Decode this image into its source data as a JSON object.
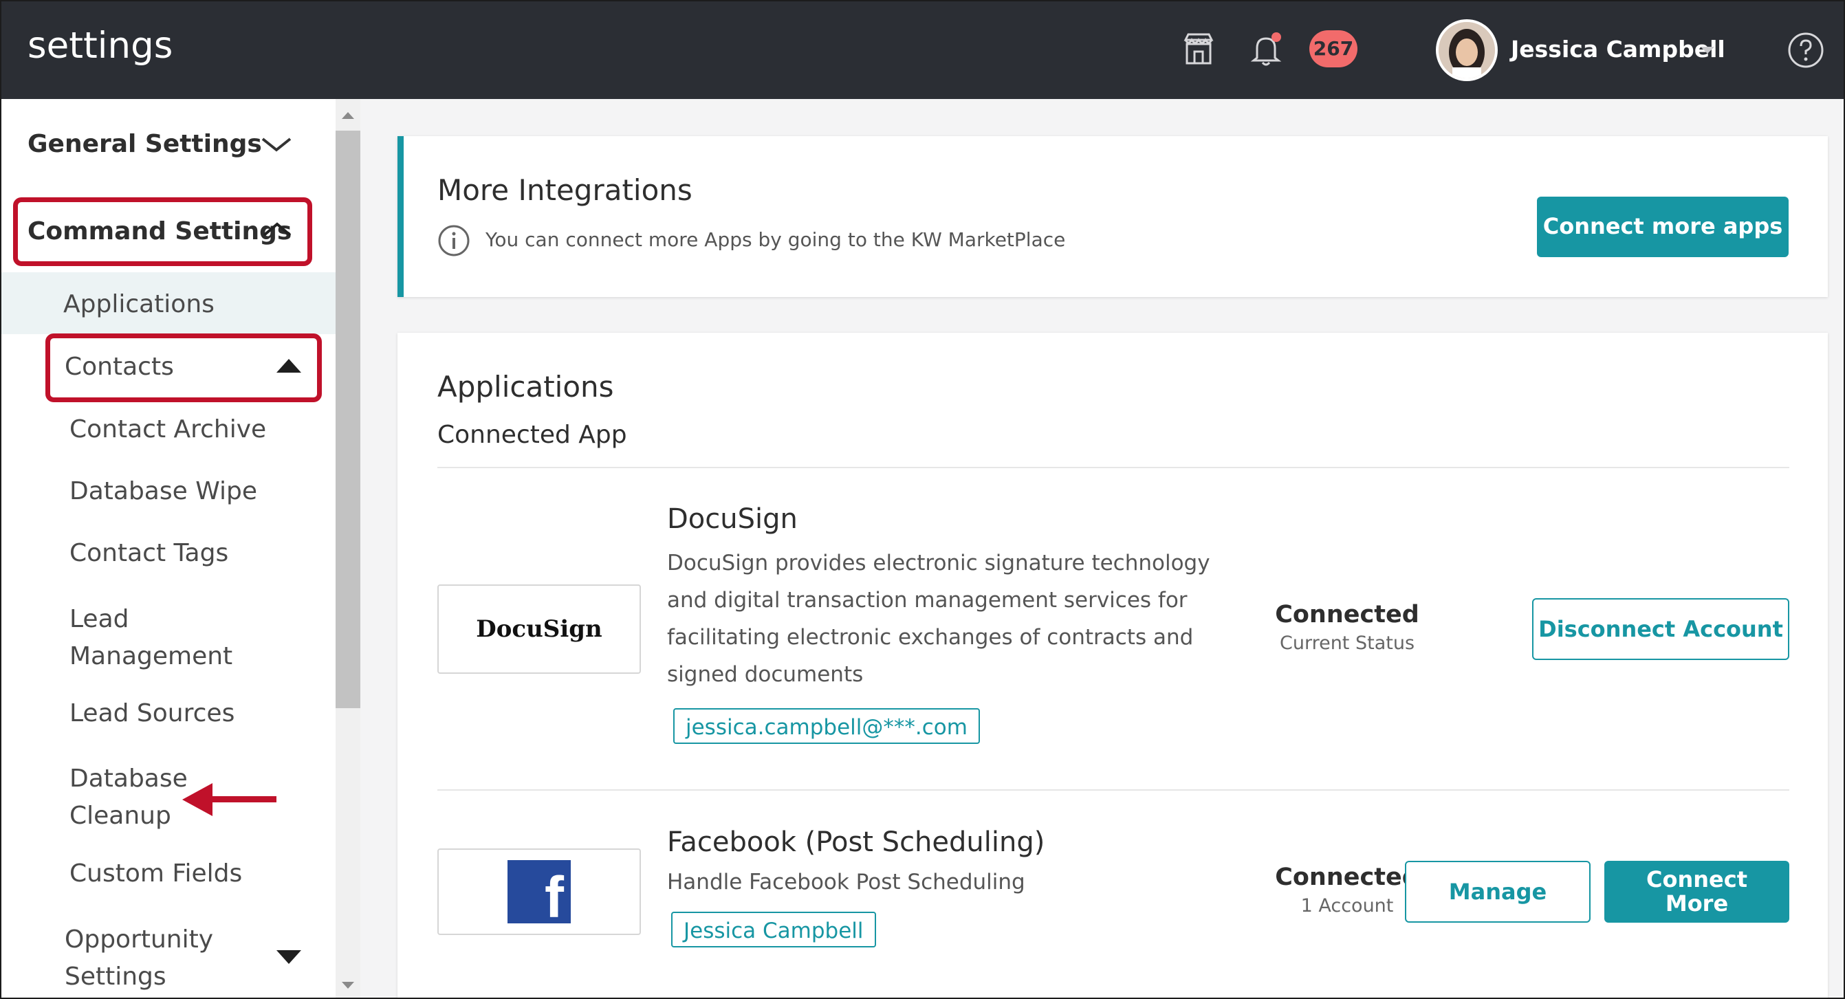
{
  "header": {
    "title": "settings",
    "notification_count": "267",
    "user_name": "Jessica Campbell",
    "icons": [
      "marketplace-icon",
      "bell-icon",
      "user-dropdown-caret-icon",
      "help-icon"
    ]
  },
  "sidebar": {
    "general_settings": "General Settings",
    "command_settings": "Command Settings",
    "items": [
      {
        "label": "Applications"
      },
      {
        "label": "Contacts"
      },
      {
        "label": "Contact Archive"
      },
      {
        "label": "Database Wipe"
      },
      {
        "label": "Contact Tags"
      },
      {
        "label": "Lead\nManagement"
      },
      {
        "label": "Lead Sources"
      },
      {
        "label": "Database\nCleanup"
      },
      {
        "label": "Custom Fields"
      },
      {
        "label": "Opportunity\nSettings"
      }
    ]
  },
  "integrations": {
    "title": "More Integrations",
    "info": "You can connect more Apps by going to the KW MarketPlace",
    "button": "Connect more apps"
  },
  "applications": {
    "title": "Applications",
    "subtitle": "Connected App",
    "apps": [
      {
        "name": "DocuSign",
        "logo_text": "DocuSign",
        "description": "DocuSign provides electronic signature technology and digital transaction management services for facilitating electronic exchanges of contracts and signed documents",
        "account": "jessica.campbell@***.com",
        "status": "Connected",
        "status_sub": "Current Status",
        "button": "Disconnect Account"
      },
      {
        "name": "Facebook (Post Scheduling)",
        "logo_text": "f",
        "description": "Handle Facebook Post Scheduling",
        "account": "Jessica Campbell",
        "status": "Connected",
        "status_sub": "1 Account",
        "button_manage": "Manage",
        "button_connect": "Connect\nMore"
      }
    ]
  },
  "colors": {
    "accent": "#1796a3",
    "topbar": "#2b2e34",
    "highlight_red": "#c0112a",
    "badge": "#f26b6b"
  }
}
